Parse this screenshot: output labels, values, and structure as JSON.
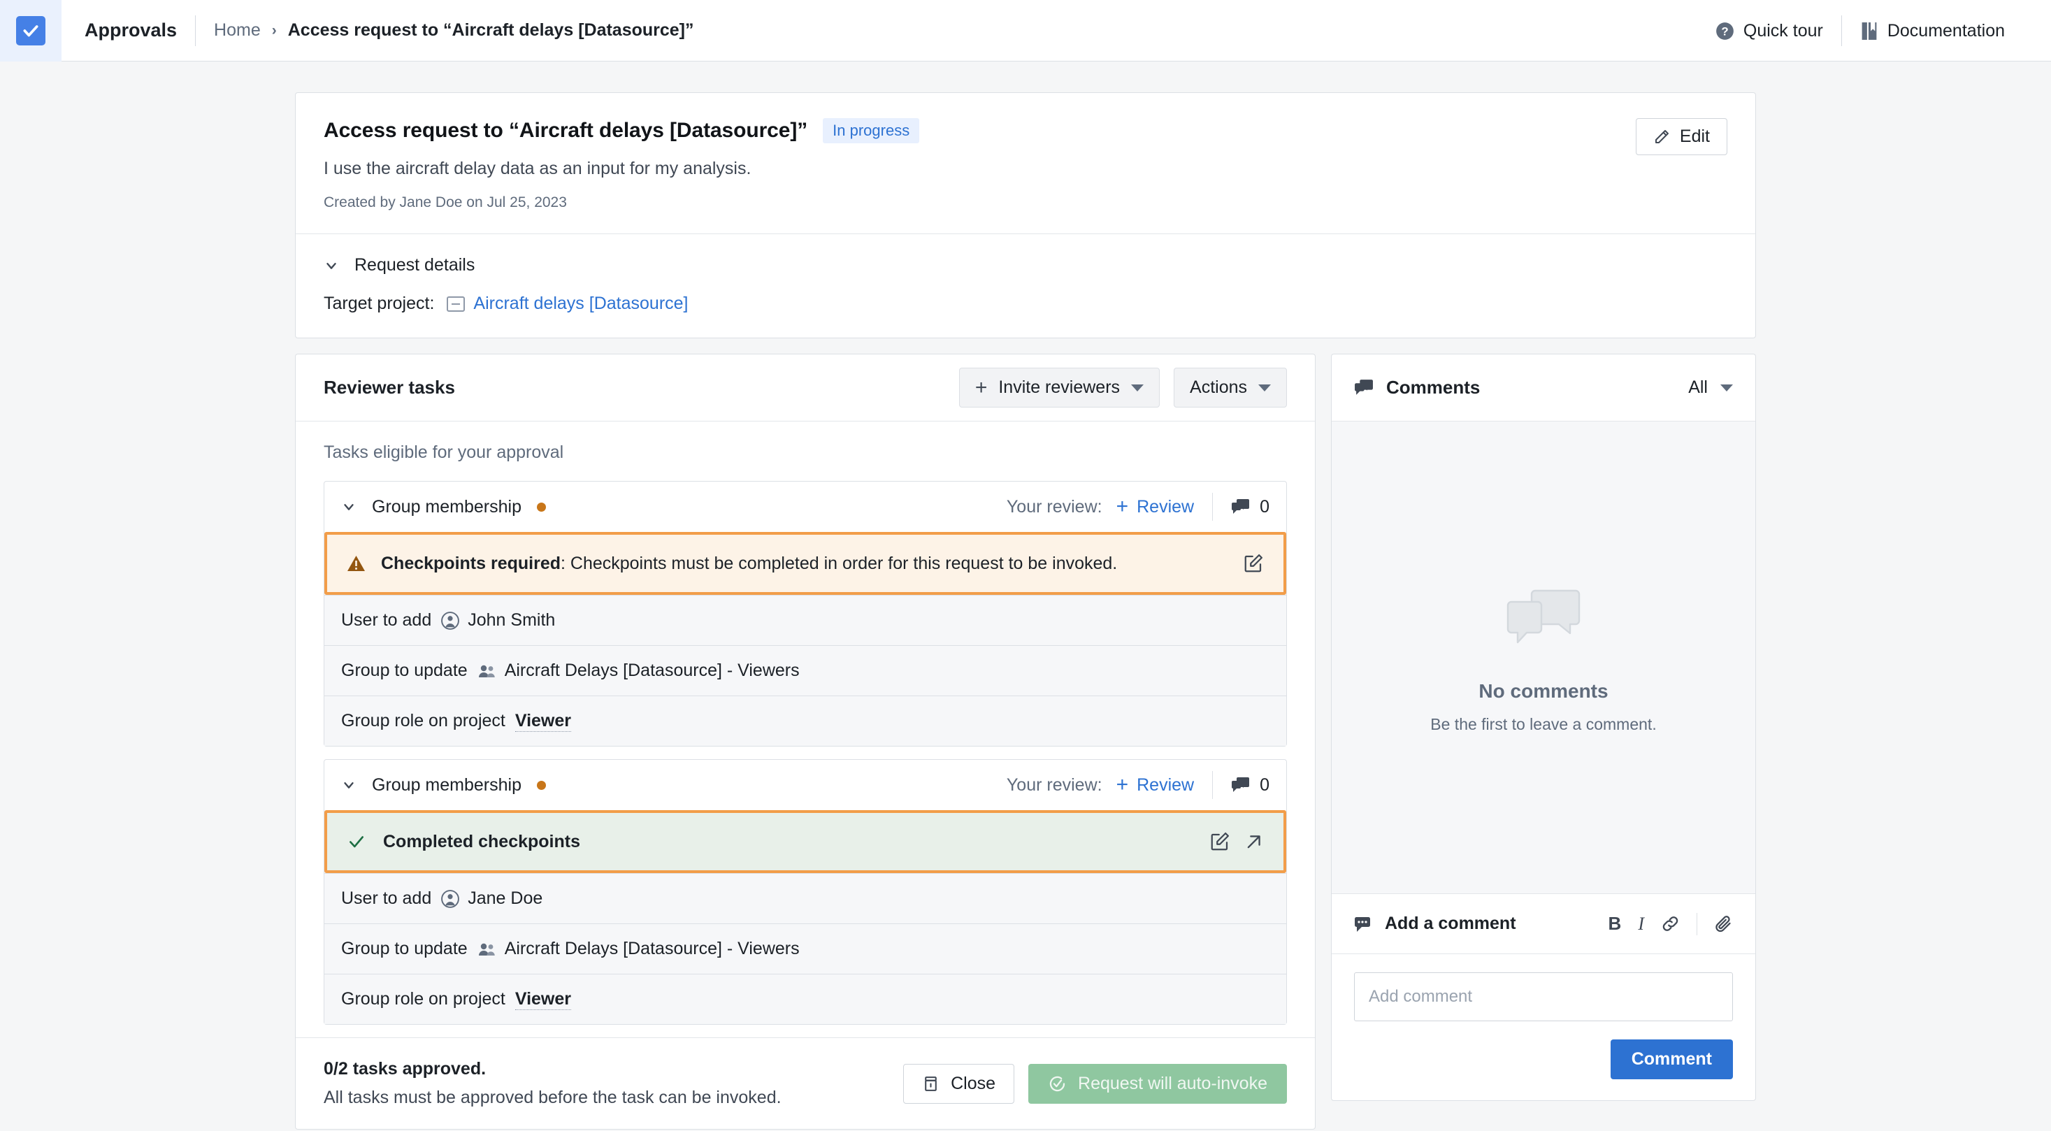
{
  "topbar": {
    "logo_icon": "check-icon",
    "app_title": "Approvals",
    "breadcrumb": {
      "home": "Home",
      "separator": "›",
      "current": "Access request to “Aircraft delays [Datasource]”"
    },
    "quick_tour": "Quick tour",
    "documentation": "Documentation"
  },
  "request": {
    "title": "Access request to “Aircraft  delays [Datasource]”",
    "status_badge": "In progress",
    "description": "I use the aircraft delay data as an input for my analysis.",
    "meta": "Created by Jane Doe on Jul 25, 2023",
    "edit_label": "Edit",
    "details_label": "Request details",
    "target_label": "Target project:",
    "target_project": "Aircraft delays [Datasource]"
  },
  "reviewer_tasks": {
    "title": "Reviewer tasks",
    "invite_label": "Invite reviewers",
    "actions_label": "Actions",
    "eligible_label": "Tasks eligible for your approval",
    "tasks": [
      {
        "name": "Group membership",
        "your_review_label": "Your review:",
        "review_label": "Review",
        "comment_count": "0",
        "banner": {
          "type": "warning",
          "icon": "warning-icon",
          "strong": "Checkpoints required",
          "text": ": Checkpoints must be completed in order for this request to be invoked."
        },
        "rows": [
          {
            "key": "User to add",
            "icon": "user-icon",
            "value": "John Smith",
            "strong": false
          },
          {
            "key": "Group to update",
            "icon": "group-icon",
            "value": "Aircraft Delays [Datasource] - Viewers",
            "strong": false
          },
          {
            "key": "Group role on project",
            "icon": "",
            "value": "Viewer",
            "strong": true
          }
        ]
      },
      {
        "name": "Group membership",
        "your_review_label": "Your review:",
        "review_label": "Review",
        "comment_count": "0",
        "banner": {
          "type": "success",
          "icon": "check-icon",
          "strong": "Completed checkpoints",
          "text": ""
        },
        "rows": [
          {
            "key": "User to add",
            "icon": "user-icon",
            "value": "Jane Doe",
            "strong": false
          },
          {
            "key": "Group to update",
            "icon": "group-icon",
            "value": "Aircraft Delays [Datasource] - Viewers",
            "strong": false
          },
          {
            "key": "Group role on project",
            "icon": "",
            "value": "Viewer",
            "strong": true
          }
        ]
      }
    ],
    "footer": {
      "approved_status": "0/2 tasks approved.",
      "approved_hint": "All tasks must be approved before the task can be invoked.",
      "close_label": "Close",
      "invoke_label": "Request will auto-invoke"
    }
  },
  "comments": {
    "title": "Comments",
    "filter": "All",
    "empty_title": "No comments",
    "empty_sub": "Be the first to leave a comment.",
    "compose_title": "Add a comment",
    "tool_bold": "B",
    "tool_italic": "I",
    "input_value": "",
    "input_placeholder": "Add comment",
    "submit_label": "Comment"
  },
  "colors": {
    "accent_blue": "#2d72d2",
    "highlight_orange": "#f29d49",
    "warning_bg": "#fdf3e7",
    "success_bg": "#e8f0e9",
    "success_green": "#1c6e42",
    "invoke_green": "#8fc7a0"
  }
}
